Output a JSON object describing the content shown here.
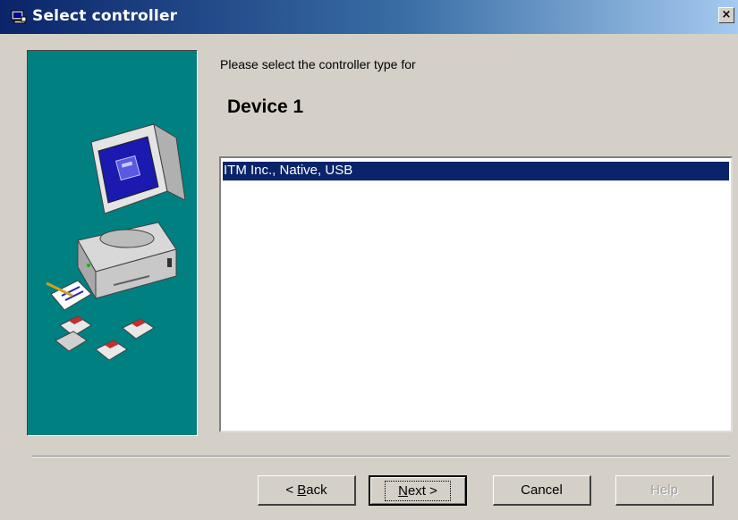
{
  "window": {
    "title": "Select controller",
    "close_label": "×"
  },
  "prompt": "Please select  the controller type for",
  "device_name": "Device 1",
  "controller_list": {
    "items": [
      {
        "label": "ITM Inc., Native, USB",
        "selected": true
      }
    ]
  },
  "buttons": {
    "back": {
      "prefix": "< ",
      "mnemonic": "B",
      "rest": "ack",
      "enabled": true
    },
    "next": {
      "mnemonic": "N",
      "rest": "ext >",
      "enabled": true,
      "default": true
    },
    "cancel": {
      "label": "Cancel",
      "enabled": true
    },
    "help": {
      "label": "Help",
      "enabled": false
    }
  },
  "colors": {
    "titlebar_start": "#0a246a",
    "side_panel": "#008080",
    "selection": "#0a246a",
    "dialog_face": "#d4d0c8"
  }
}
